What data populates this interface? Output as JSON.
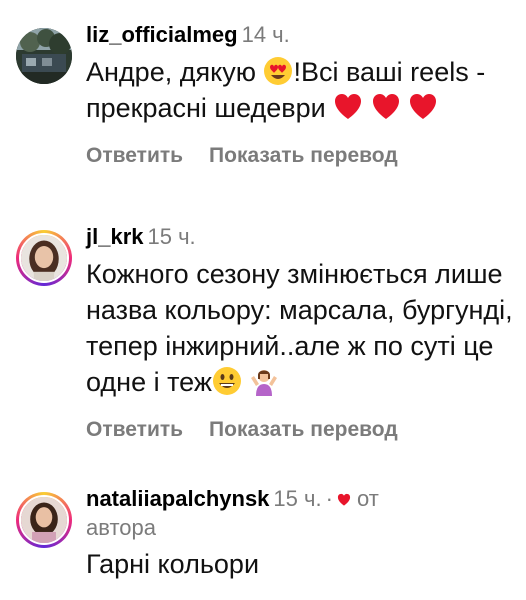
{
  "comments": [
    {
      "username": "liz_officialmeg",
      "time": "14 ч.",
      "text_parts": [
        "Андре, дякую ",
        "!Всі ваші reels - прекрасні шедеври "
      ],
      "emoji_names": [
        "heart-eyes-emoji",
        "red-heart-emoji"
      ],
      "reply_label": "Ответить",
      "translate_label": "Показать перевод"
    },
    {
      "username": "jl_krk",
      "time": "15 ч.",
      "text": "Кожного сезону змінюється лише назва кольору: марсала, бургунді, тепер інжирний..але ж по суті це одне і теж",
      "emoji_names": [
        "grinning-emoji",
        "person-shrugging-emoji"
      ],
      "reply_label": "Ответить",
      "translate_label": "Показать перевод"
    },
    {
      "username": "nataliiapalchynsk",
      "time": "15 ч.",
      "separator": "·",
      "author_label_1": "от",
      "author_label_2": "автора",
      "text": "Гарні кольори"
    }
  ],
  "colors": {
    "muted": "#7b7b7b",
    "heart": "#e8152b",
    "emoji_yellow": "#ffcc33"
  }
}
